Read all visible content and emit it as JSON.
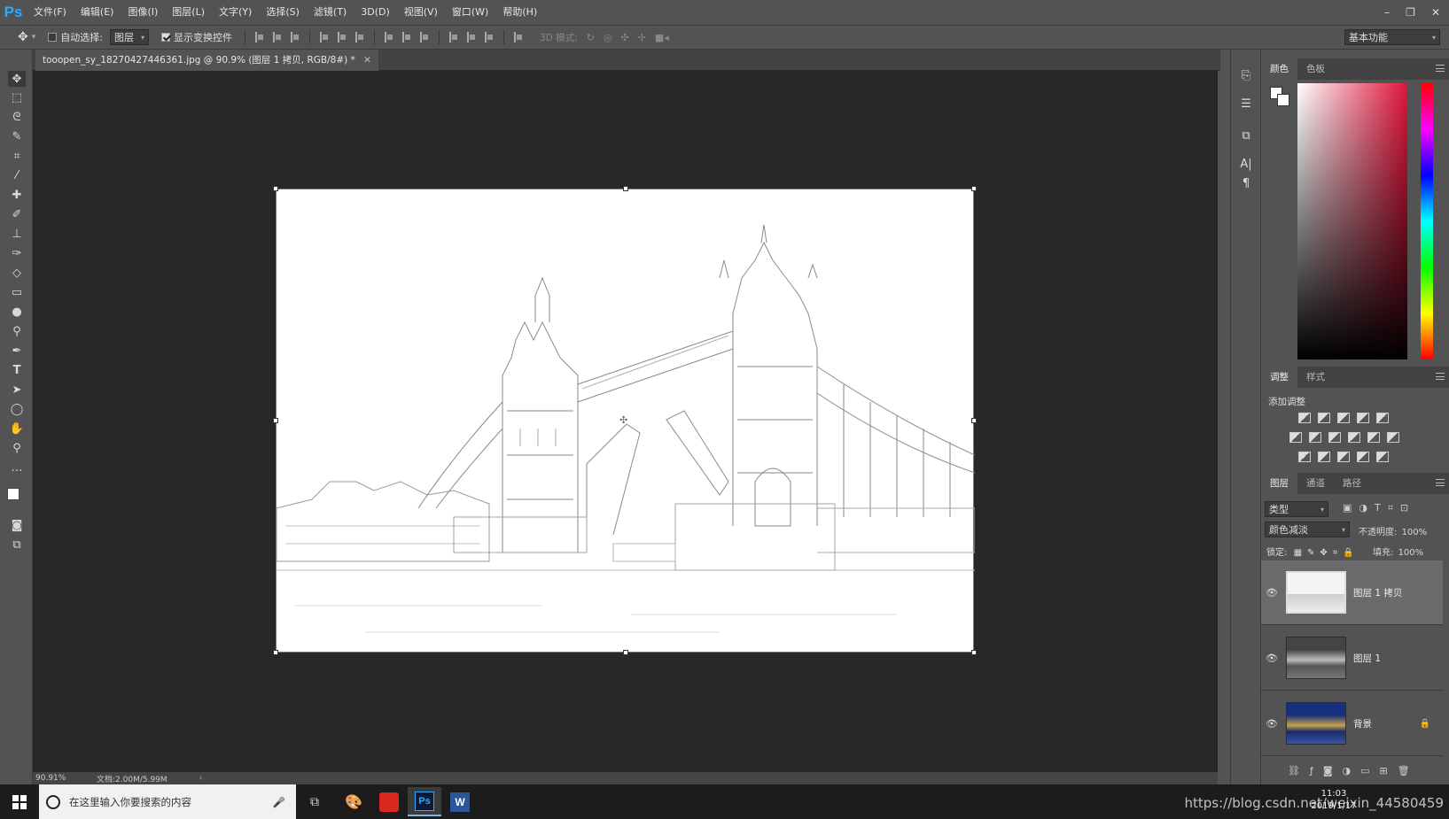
{
  "app": {
    "logo": "Ps"
  },
  "menu": [
    "文件(F)",
    "编辑(E)",
    "图像(I)",
    "图层(L)",
    "文字(Y)",
    "选择(S)",
    "滤镜(T)",
    "3D(D)",
    "视图(V)",
    "窗口(W)",
    "帮助(H)"
  ],
  "window_controls": [
    "–",
    "❐",
    "✕"
  ],
  "options": {
    "auto_select_label": "自动选择:",
    "auto_select_value": "图层",
    "show_transform_label": "显示变换控件",
    "mode_3d_label": "3D 模式:",
    "workspace": "基本功能"
  },
  "document": {
    "tab_title": "tooopen_sy_18270427446361.jpg @ 90.9% (图层 1 拷贝, RGB/8#) *",
    "zoom": "90.91%",
    "doc_size": "文档:2.00M/5.99M"
  },
  "panels": {
    "color_tabs": [
      "颜色",
      "色板"
    ],
    "adjust_tabs": [
      "调整",
      "样式"
    ],
    "add_adjust": "添加调整",
    "layer_tabs": [
      "图层",
      "通道",
      "路径"
    ],
    "filter_kind": "类型",
    "blend_mode": "颜色减淡",
    "opacity_label": "不透明度:",
    "opacity_value": "100%",
    "lock_label": "锁定:",
    "fill_label": "填充:",
    "fill_value": "100%"
  },
  "layers": [
    {
      "name": "图层 1 拷贝",
      "selected": true
    },
    {
      "name": "图层 1",
      "selected": false
    },
    {
      "name": "背景",
      "selected": false,
      "locked": true
    }
  ],
  "taskbar": {
    "search_placeholder": "在这里输入你要搜索的内容",
    "time": "11:03",
    "date": "2019/1/17",
    "watermark": "https://blog.csdn.net/weixin_44580459"
  },
  "colors": {
    "accent": "#31a8ff",
    "bg": "#535353",
    "canvas": "#282828"
  }
}
